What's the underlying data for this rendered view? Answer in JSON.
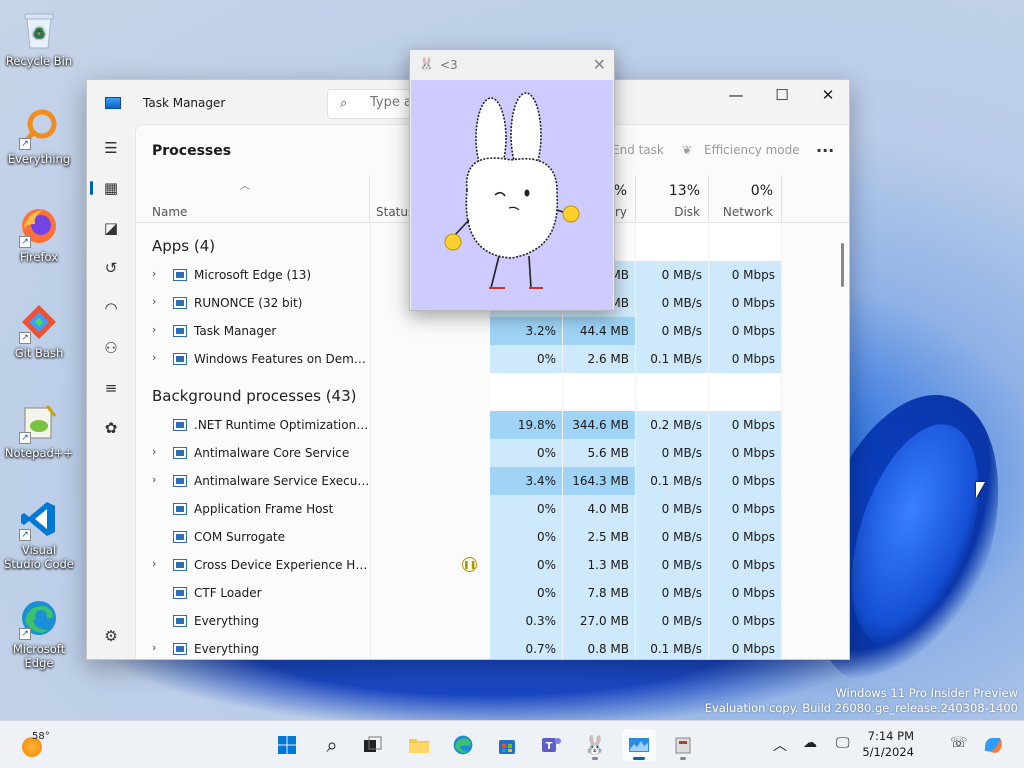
{
  "desktop_icons": [
    {
      "label": "Recycle Bin",
      "icon": "recycle-bin-icon"
    },
    {
      "label": "Everything",
      "icon": "everything-search-icon"
    },
    {
      "label": "Firefox",
      "icon": "firefox-icon"
    },
    {
      "label": "Git Bash",
      "icon": "git-bash-icon"
    },
    {
      "label": "Notepad++",
      "icon": "notepadpp-icon"
    },
    {
      "label": "Visual Studio Code",
      "icon": "vscode-icon"
    },
    {
      "label": "Microsoft Edge",
      "icon": "edge-icon"
    }
  ],
  "task_manager": {
    "title": "Task Manager",
    "search_placeholder": "Type a",
    "page_title": "Processes",
    "toolbar": {
      "end_task": "End task",
      "efficiency_mode": "Efficiency mode",
      "more": "..."
    },
    "columns": {
      "name": "Name",
      "status": "Status",
      "memory_pct": "%",
      "memory": "ory",
      "disk_pct": "13%",
      "disk": "Disk",
      "network_pct": "0%",
      "network": "Network"
    },
    "apps_section": "Apps (4)",
    "bg_section": "Background processes (43)",
    "apps": [
      {
        "name": "Microsoft Edge (13)",
        "cpu": "",
        "mem": "MB",
        "disk": "0 MB/s",
        "net": "0 Mbps",
        "expand": true,
        "icon": "edge-icon"
      },
      {
        "name": "RUNONCE (32 bit)",
        "cpu": "",
        "mem": "MB",
        "disk": "0 MB/s",
        "net": "0 Mbps",
        "expand": true,
        "icon": "runonce-icon"
      },
      {
        "name": "Task Manager",
        "cpu": "3.2%",
        "mem": "44.4 MB",
        "disk": "0 MB/s",
        "net": "0 Mbps",
        "expand": true,
        "icon": "task-manager-icon"
      },
      {
        "name": "Windows Features on Deman...",
        "cpu": "0%",
        "mem": "2.6 MB",
        "disk": "0.1 MB/s",
        "net": "0 Mbps",
        "expand": true,
        "icon": "windows-features-icon"
      }
    ],
    "background": [
      {
        "name": ".NET Runtime Optimization Se...",
        "cpu": "19.8%",
        "mem": "344.6 MB",
        "disk": "0.2 MB/s",
        "net": "0 Mbps",
        "expand": false
      },
      {
        "name": "Antimalware Core Service",
        "cpu": "0%",
        "mem": "5.6 MB",
        "disk": "0 MB/s",
        "net": "0 Mbps",
        "expand": true
      },
      {
        "name": "Antimalware Service Executable",
        "cpu": "3.4%",
        "mem": "164.3 MB",
        "disk": "0.1 MB/s",
        "net": "0 Mbps",
        "expand": true
      },
      {
        "name": "Application Frame Host",
        "cpu": "0%",
        "mem": "4.0 MB",
        "disk": "0 MB/s",
        "net": "0 Mbps",
        "expand": false
      },
      {
        "name": "COM Surrogate",
        "cpu": "0%",
        "mem": "2.5 MB",
        "disk": "0 MB/s",
        "net": "0 Mbps",
        "expand": false
      },
      {
        "name": "Cross Device Experience Host ...",
        "cpu": "0%",
        "mem": "1.3 MB",
        "disk": "0 MB/s",
        "net": "0 Mbps",
        "expand": true,
        "paused": true
      },
      {
        "name": "CTF Loader",
        "cpu": "0%",
        "mem": "7.8 MB",
        "disk": "0 MB/s",
        "net": "0 Mbps",
        "expand": false
      },
      {
        "name": "Everything",
        "cpu": "0.3%",
        "mem": "27.0 MB",
        "disk": "0 MB/s",
        "net": "0 Mbps",
        "expand": false
      },
      {
        "name": "Everything",
        "cpu": "0.7%",
        "mem": "0.8 MB",
        "disk": "0.1 MB/s",
        "net": "0 Mbps",
        "expand": true
      }
    ]
  },
  "popup": {
    "title": "<3"
  },
  "watermark": {
    "line1": "Windows 11 Pro Insider Preview",
    "line2": "Evaluation copy. Build 26080.ge_release.240308-1400"
  },
  "taskbar": {
    "weather_temp": "58°",
    "time": "7:14 PM",
    "date": "5/1/2024"
  },
  "colors": {
    "cpu_high": "#9fd4f7",
    "cpu_low": "#cde9fb",
    "accent": "#0067c0"
  }
}
